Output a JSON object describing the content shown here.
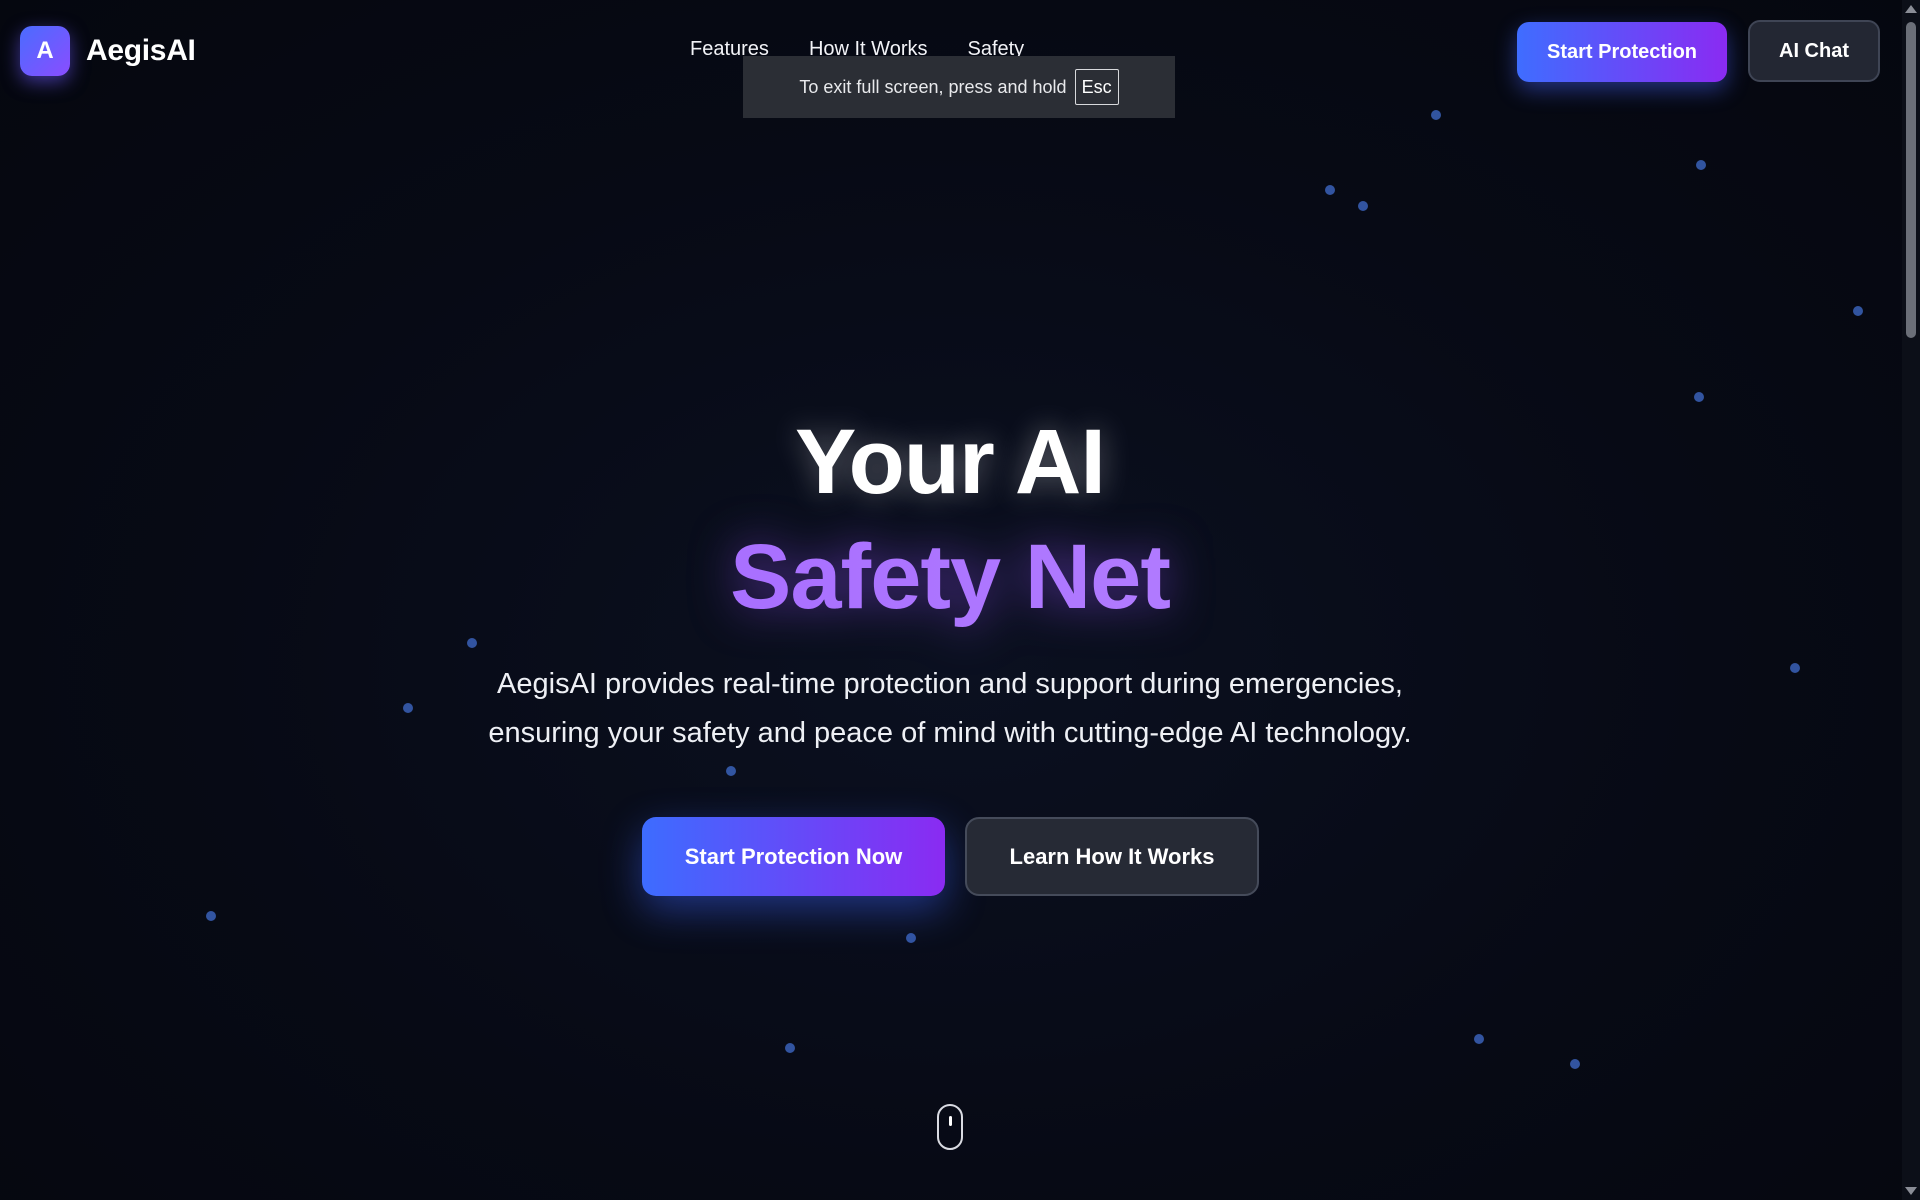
{
  "header": {
    "logo_letter": "A",
    "brand": "AegisAI",
    "nav": [
      "Features",
      "How It Works",
      "Safety"
    ],
    "primary_button": "Start Protection",
    "secondary_button": "AI Chat"
  },
  "fullscreen_toast": {
    "text": "To exit full screen, press and hold",
    "key": "Esc"
  },
  "hero": {
    "title_line1": "Your AI",
    "title_line2": "Safety Net",
    "description_line1": "AegisAI provides real-time protection and support during emergencies,",
    "description_line2": "ensuring your safety and peace of mind with cutting-edge AI technology.",
    "primary_cta": "Start Protection Now",
    "secondary_cta": "Learn How It Works"
  },
  "colors": {
    "background": "#060913",
    "accent_blue": "#3d6cff",
    "accent_purple": "#8a2bf2",
    "dot": "#3a62b8"
  },
  "icons": {
    "scroll_indicator": "mouse-scroll-icon"
  }
}
